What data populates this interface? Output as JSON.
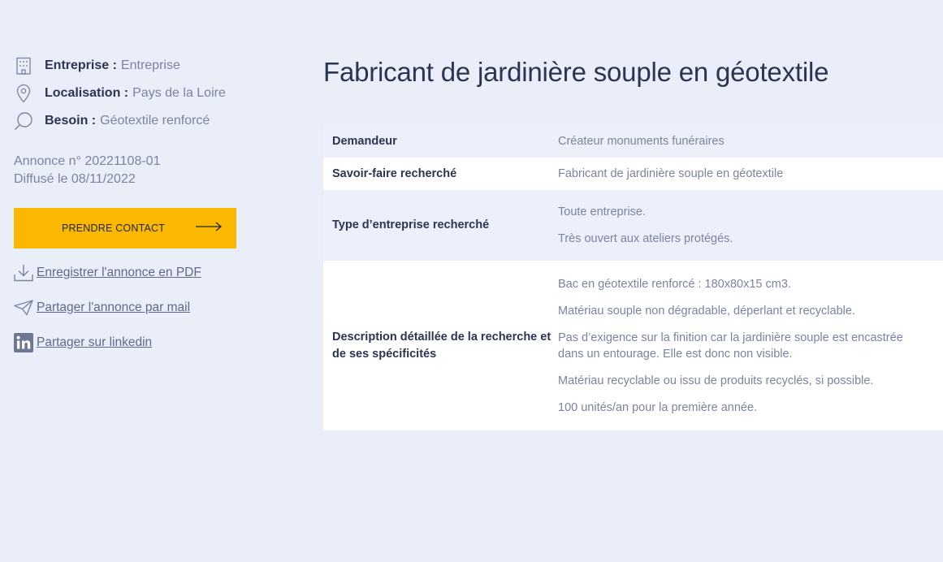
{
  "sidebar": {
    "meta": [
      {
        "icon": "building-icon",
        "label": "Entreprise :",
        "value": "Entreprise"
      },
      {
        "icon": "location-pin-icon",
        "label": "Localisation :",
        "value": "Pays de la Loire"
      },
      {
        "icon": "search-icon",
        "label": "Besoin :",
        "value": "Géotextile renforcé"
      }
    ],
    "annonce_number": "Annonce n° 20221108-01",
    "published": "Diffusé le 08/11/2022",
    "contact_button": "PRENDRE CONTACT",
    "actions": {
      "pdf": "Enregistrer l'annonce en PDF",
      "mail": "Partager l'annonce par mail",
      "linkedin": "Partager sur linkedin"
    }
  },
  "main": {
    "title": "Fabricant de jardinière souple en géotextile",
    "rows": [
      {
        "label": "Demandeur",
        "values": [
          "Créateur monuments funéraires"
        ]
      },
      {
        "label": "Savoir-faire recherché",
        "values": [
          "Fabricant de jardinière souple en géotextile"
        ]
      },
      {
        "label": "Type d’entreprise recherché",
        "values": [
          "Toute entreprise.",
          "Très ouvert aux ateliers protégés."
        ]
      },
      {
        "label": "Description détaillée de la recherche et de ses spécificités",
        "values": [
          "Bac en géotextile renforcé : 180x80x15 cm3.",
          "Matériau souple non dégradable, déperlant et recyclable.",
          "Pas d’exigence sur la finition car la jardinière souple est encastrée dans un entourage. Elle est donc non visible.",
          "Matériau recyclable ou issu de produits recyclés, si possible.",
          "100 unités/an pour la première année."
        ]
      }
    ]
  },
  "colors": {
    "background": "#eaeef9",
    "accent": "#fbb800",
    "text_dark": "#2b3550",
    "text_muted": "#7b849e"
  }
}
